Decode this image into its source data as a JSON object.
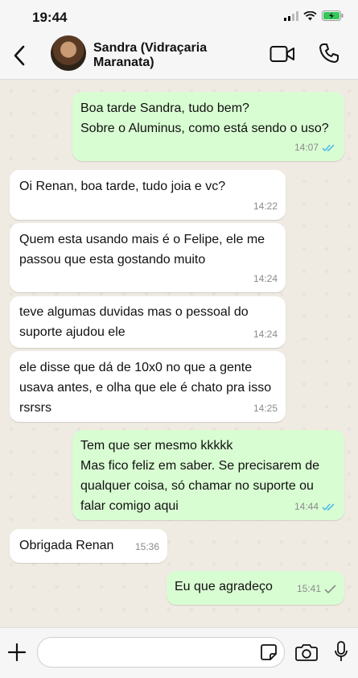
{
  "status_bar": {
    "time": "19:44"
  },
  "header": {
    "contact_name": "Sandra (Vidraçaria Maranata)"
  },
  "messages": [
    {
      "direction": "out",
      "text": "Boa tarde Sandra, tudo bem?\nSobre o Aluminus, como está sendo o uso?",
      "time": "14:07",
      "ticks": "read"
    },
    {
      "direction": "in",
      "text": "Oi Renan, boa tarde, tudo joia e vc?",
      "time": "14:22"
    },
    {
      "direction": "in",
      "text": "Quem esta usando mais é o Felipe, ele me passou que esta gostando muito",
      "time": "14:24"
    },
    {
      "direction": "in",
      "text": "teve algumas duvidas mas o pessoal do suporte ajudou ele",
      "time": "14:24"
    },
    {
      "direction": "in",
      "text": "ele disse que dá de 10x0 no que a gente usava antes, e olha que ele é chato pra isso rsrsrs",
      "time": "14:25"
    },
    {
      "direction": "out",
      "text": "Tem que ser mesmo kkkkk\nMas fico feliz em saber. Se precisarem de qualquer coisa, só chamar no suporte ou falar comigo aqui",
      "time": "14:44",
      "ticks": "read"
    },
    {
      "direction": "in",
      "text": "Obrigada Renan",
      "time": "15:36"
    },
    {
      "direction": "out",
      "text": "Eu que agradeço",
      "time": "15:41",
      "ticks": "sent"
    }
  ],
  "colors": {
    "read_ticks": "#53bdeb",
    "sent_tick": "#8a8a8a",
    "outgoing_bubble": "#d9fdd3",
    "incoming_bubble": "#ffffff"
  },
  "icons": [
    "back-icon",
    "video-call-icon",
    "phone-icon",
    "plus-icon",
    "sticker-icon",
    "camera-icon",
    "microphone-icon",
    "signal-icon",
    "wifi-icon",
    "battery-icon"
  ]
}
